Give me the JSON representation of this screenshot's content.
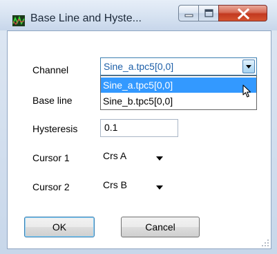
{
  "window": {
    "title": "Base Line and Hyste...",
    "title_icon": "app-icon",
    "buttons": {
      "minimize": "minimize-icon",
      "maximize": "maximize-icon",
      "close": "close-icon"
    }
  },
  "form": {
    "channel": {
      "label": "Channel",
      "value": "Sine_a.tpc5[0,0]",
      "options": [
        "Sine_a.tpc5[0,0]",
        "Sine_b.tpc5[0,0]"
      ],
      "highlighted": "Sine_a.tpc5[0,0]"
    },
    "base_line": {
      "label": "Base line"
    },
    "hysteresis": {
      "label": "Hysteresis",
      "value": "0.1"
    },
    "cursor1": {
      "label": "Cursor 1",
      "value": "Crs A"
    },
    "cursor2": {
      "label": "Cursor 2",
      "value": "Crs B"
    }
  },
  "actions": {
    "ok_label": "OK",
    "cancel_label": "Cancel"
  },
  "colors": {
    "selection": "#3399ff",
    "focus_border": "#3c7fb1",
    "close_button": "#c2391f"
  }
}
